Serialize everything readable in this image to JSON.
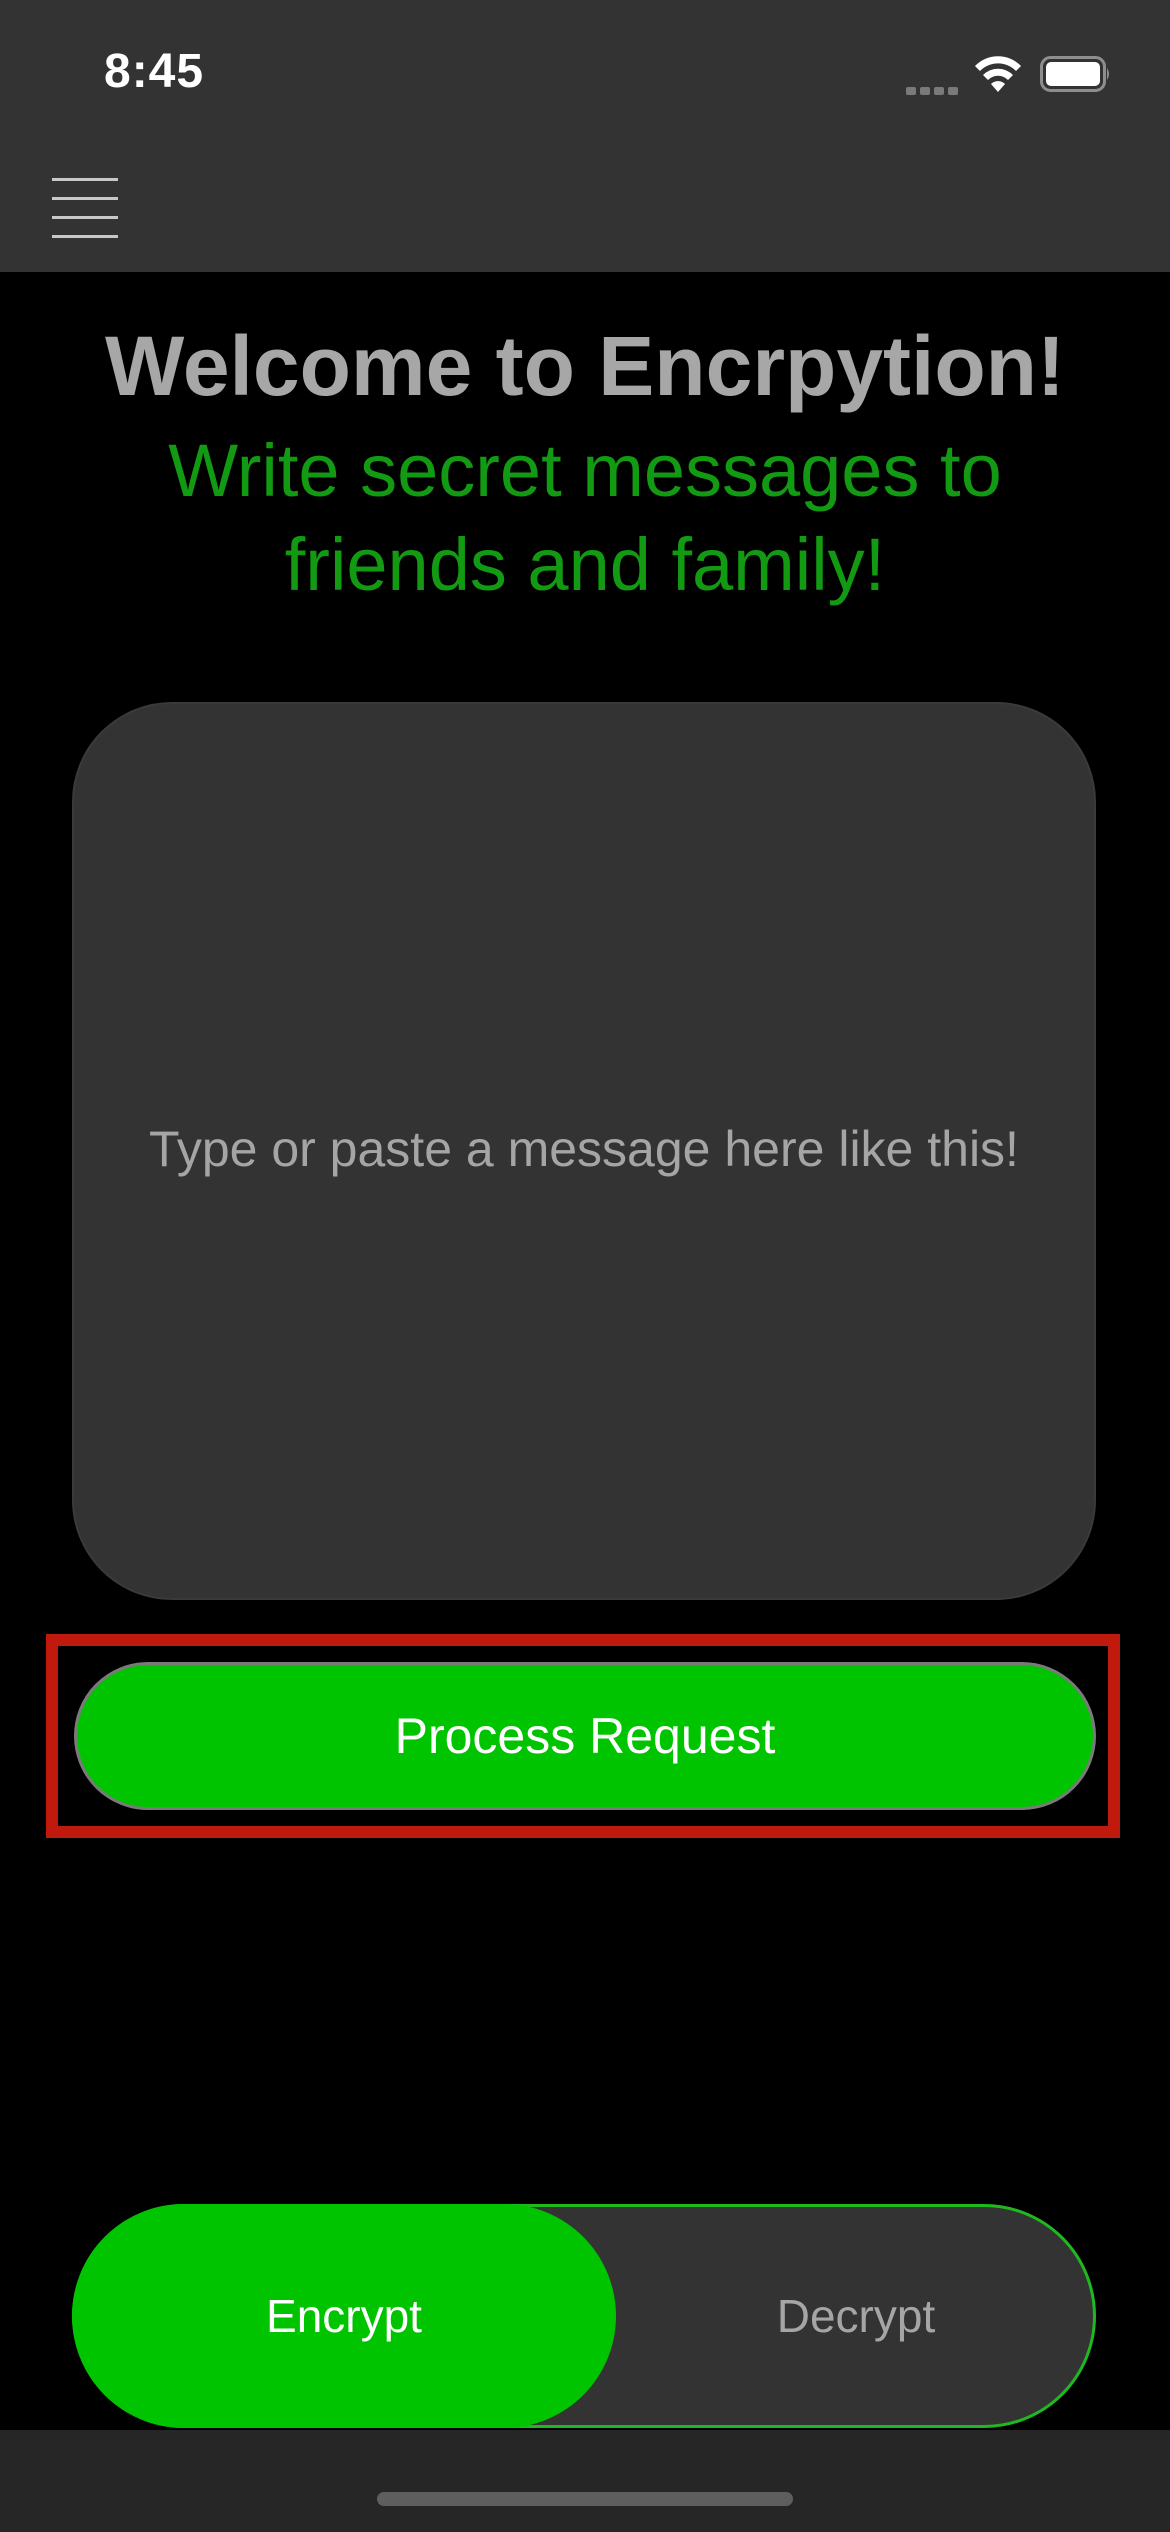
{
  "status_bar": {
    "time": "8:45",
    "icons": [
      "cellular-signal-icon",
      "wifi-icon",
      "battery-icon"
    ]
  },
  "nav_bar": {
    "menu_icon": "hamburger-menu-icon"
  },
  "header": {
    "title": "Welcome to Encrpytion!",
    "subtitle": "Write secret messages to friends and family!"
  },
  "message_input": {
    "value": "",
    "placeholder": "Type or paste a message here like this!"
  },
  "process_button": {
    "label": "Process Request"
  },
  "mode_toggle": {
    "options": [
      "Encrypt",
      "Decrypt"
    ],
    "selected": "Encrypt"
  },
  "colors": {
    "accent": "#00c400",
    "subtitle": "#139a13",
    "title": "#a7a7a7",
    "surface": "#333333",
    "background": "#000000",
    "highlight": "#c0190d"
  }
}
